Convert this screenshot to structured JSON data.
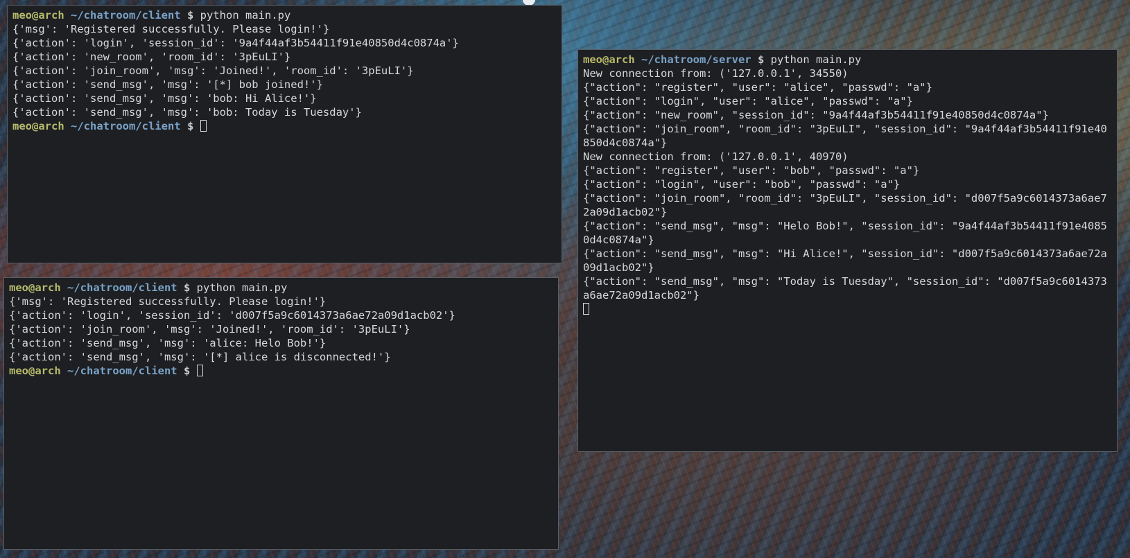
{
  "client_top": {
    "prompt": {
      "user": "meo@arch",
      "path": "~/chatroom/client",
      "sign": "$",
      "command": "python main.py"
    },
    "lines": [
      "{'msg': 'Registered successfully. Please login!'}",
      "{'action': 'login', 'session_id': '9a4f44af3b54411f91e40850d4c0874a'}",
      "{'action': 'new_room', 'room_id': '3pEuLI'}",
      "{'action': 'join_room', 'msg': 'Joined!', 'room_id': '3pEuLI'}",
      "{'action': 'send_msg', 'msg': '[*] bob joined!'}",
      "{'action': 'send_msg', 'msg': 'bob: Hi Alice!'}",
      "{'action': 'send_msg', 'msg': 'bob: Today is Tuesday'}"
    ],
    "end_prompt": {
      "user": "meo@arch",
      "path": "~/chatroom/client",
      "sign": "$"
    }
  },
  "client_bottom": {
    "prompt": {
      "user": "meo@arch",
      "path": "~/chatroom/client",
      "sign": "$",
      "command": "python main.py"
    },
    "lines": [
      "{'msg': 'Registered successfully. Please login!'}",
      "{'action': 'login', 'session_id': 'd007f5a9c6014373a6ae72a09d1acb02'}",
      "{'action': 'join_room', 'msg': 'Joined!', 'room_id': '3pEuLI'}",
      "{'action': 'send_msg', 'msg': 'alice: Helo Bob!'}",
      "{'action': 'send_msg', 'msg': '[*] alice is disconnected!'}"
    ],
    "end_prompt": {
      "user": "meo@arch",
      "path": "~/chatroom/client",
      "sign": "$"
    }
  },
  "server": {
    "prompt": {
      "user": "meo@arch",
      "path": "~/chatroom/server",
      "sign": "$",
      "command": "python main.py"
    },
    "lines": [
      "New connection from: ('127.0.0.1', 34550)",
      "{\"action\": \"register\", \"user\": \"alice\", \"passwd\": \"a\"}",
      "{\"action\": \"login\", \"user\": \"alice\", \"passwd\": \"a\"}",
      "{\"action\": \"new_room\", \"session_id\": \"9a4f44af3b54411f91e40850d4c0874a\"}",
      "{\"action\": \"join_room\", \"room_id\": \"3pEuLI\", \"session_id\": \"9a4f44af3b54411f91e40850d4c0874a\"}",
      "New connection from: ('127.0.0.1', 40970)",
      "{\"action\": \"register\", \"user\": \"bob\", \"passwd\": \"a\"}",
      "{\"action\": \"login\", \"user\": \"bob\", \"passwd\": \"a\"}",
      "{\"action\": \"join_room\", \"room_id\": \"3pEuLI\", \"session_id\": \"d007f5a9c6014373a6ae72a09d1acb02\"}",
      "{\"action\": \"send_msg\", \"msg\": \"Helo Bob!\", \"session_id\": \"9a4f44af3b54411f91e40850d4c0874a\"}",
      "{\"action\": \"send_msg\", \"msg\": \"Hi Alice!\", \"session_id\": \"d007f5a9c6014373a6ae72a09d1acb02\"}",
      "{\"action\": \"send_msg\", \"msg\": \"Today is Tuesday\", \"session_id\": \"d007f5a9c6014373a6ae72a09d1acb02\"}"
    ]
  },
  "colors": {
    "terminal_bg": "#1d1f22",
    "prompt_user": "#b8bb6c",
    "prompt_path": "#7aa2c8",
    "text": "#d6d8da"
  }
}
